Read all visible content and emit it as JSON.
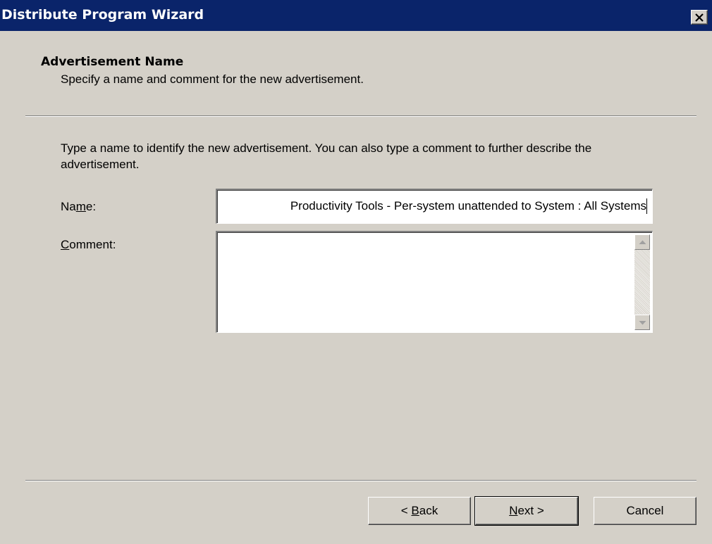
{
  "window": {
    "title": "Distribute Program Wizard",
    "close_label": "×"
  },
  "header": {
    "title": "Advertisement Name",
    "subtitle": "Specify a name and comment for the new advertisement."
  },
  "body": {
    "instructions": "Type a name to identify the new advertisement. You can also type a comment to further describe the advertisement."
  },
  "form": {
    "name": {
      "label_pre": "Na",
      "label_accel": "m",
      "label_post": "e:",
      "value": "Productivity Tools - Per-system unattended to System : All Systems"
    },
    "comment": {
      "label_pre": "",
      "label_accel": "C",
      "label_post": "omment:",
      "value": ""
    }
  },
  "buttons": {
    "back": {
      "pre": "< ",
      "accel": "B",
      "post": "ack"
    },
    "next": {
      "pre": "",
      "accel": "N",
      "post": "ext >"
    },
    "cancel": {
      "label": "Cancel"
    }
  },
  "colors": {
    "titlebar": "#0a246a",
    "face": "#d4d0c8"
  }
}
